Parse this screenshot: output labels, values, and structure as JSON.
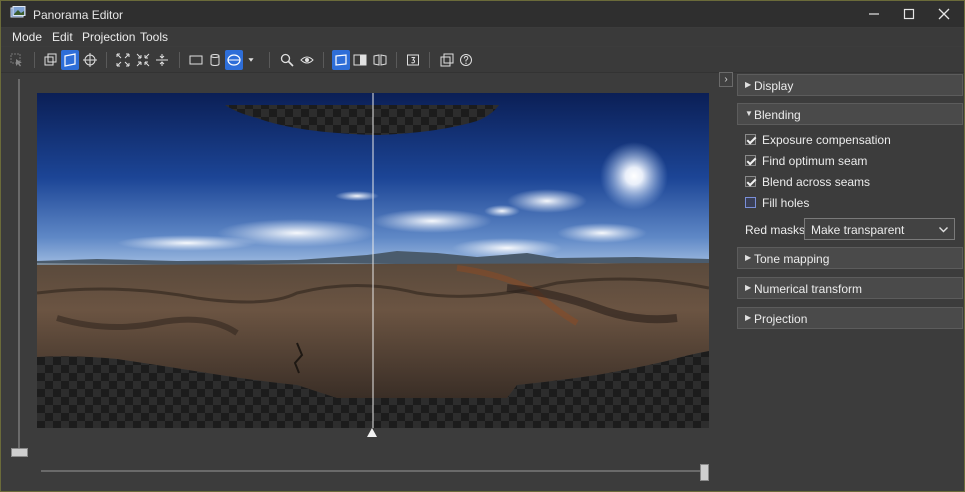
{
  "window": {
    "title": "Panorama Editor"
  },
  "menu": [
    "Mode",
    "Edit",
    "Projection",
    "Tools"
  ],
  "toolbar": {
    "icons": [
      "select-arrow-icon",
      "layers-icon",
      "crop-icon",
      "crosshair-icon",
      "fit-icon",
      "center-icon",
      "straighten-icon",
      "rectilinear-projection-icon",
      "cylindrical-projection-icon",
      "spherical-projection-icon",
      "projection-dropdown-icon",
      "zoom-icon",
      "preview-eye-icon",
      "identify-icon",
      "color-picker-icon",
      "split-view-icon",
      "number-icon",
      "overlay-icon",
      "help-icon"
    ],
    "active": [
      "crop-icon",
      "spherical-projection-icon",
      "identify-icon"
    ]
  },
  "panel": {
    "collapse_label": "›",
    "sections": {
      "display": "Display",
      "blending": "Blending",
      "tone_mapping": "Tone mapping",
      "numerical_transform": "Numerical transform",
      "projection": "Projection"
    },
    "blending": {
      "options": [
        {
          "label": "Exposure compensation",
          "checked": true
        },
        {
          "label": "Find optimum seam",
          "checked": true
        },
        {
          "label": "Blend across seams",
          "checked": true
        },
        {
          "label": "Fill holes",
          "checked": false
        }
      ],
      "red_masks_label": "Red masks:",
      "red_masks_value": "Make transparent"
    }
  },
  "colors": {
    "accent": "#2e6ed8",
    "background": "#3c3c3c",
    "titlebar": "#2f2f2f"
  },
  "sliders": {
    "vertical_value": 0,
    "horizontal_value": 1
  }
}
